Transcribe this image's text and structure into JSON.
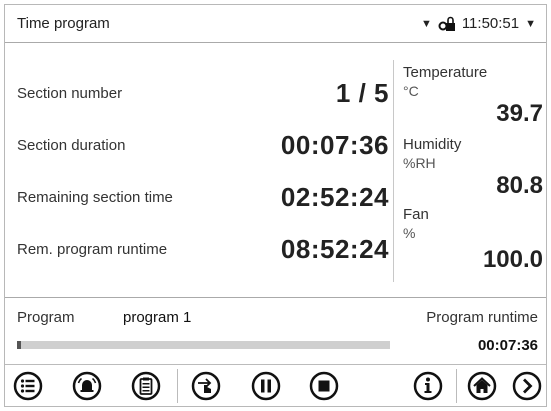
{
  "header": {
    "title": "Time program",
    "time": "11:50:51"
  },
  "section": {
    "number_label": "Section number",
    "number_value": "1 / 5",
    "duration_label": "Section duration",
    "duration_value": "00:07:36",
    "remaining_label": "Remaining section time",
    "remaining_value": "02:52:24",
    "runtime_label": "Rem. program runtime",
    "runtime_value": "08:52:24"
  },
  "readings": {
    "temperature_label": "Temperature",
    "temperature_unit": "°C",
    "temperature_value": "39.7",
    "humidity_label": "Humidity",
    "humidity_unit": "%RH",
    "humidity_value": "80.8",
    "fan_label": "Fan",
    "fan_unit": "%",
    "fan_value": "100.0"
  },
  "program": {
    "label": "Program",
    "name": "program 1",
    "runtime_label": "Program runtime",
    "runtime_value": "00:07:36",
    "progress_fraction": 0.01
  },
  "toolbar": {
    "icons": [
      "menu-icon",
      "alarm-icon",
      "clipboard-icon",
      "touch-icon",
      "pause-icon",
      "stop-icon",
      "info-icon",
      "home-icon",
      "next-icon"
    ]
  }
}
